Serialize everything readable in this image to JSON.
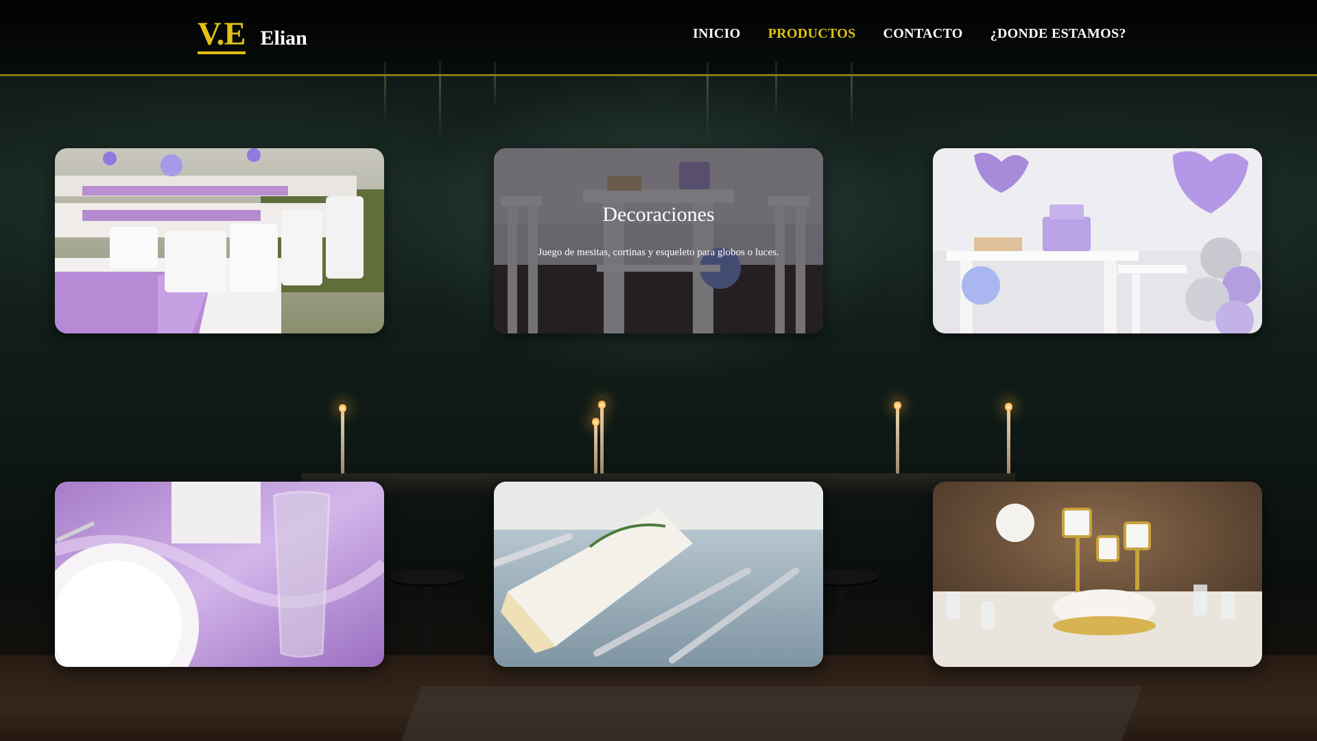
{
  "brand": {
    "mark": "V.E",
    "name": "Elian",
    "accent_color": "#e0c217"
  },
  "nav": {
    "items": [
      {
        "label": "INICIO",
        "active": false
      },
      {
        "label": "PRODUCTOS",
        "active": true
      },
      {
        "label": "CONTACTO",
        "active": false
      },
      {
        "label": "¿DONDE ESTAMOS?",
        "active": false
      }
    ]
  },
  "gallery": {
    "cards": [
      {
        "image": "event-tables-lilac-runners-photo",
        "title": "",
        "description": ""
      },
      {
        "image": "dessert-table-decor-photo",
        "title": "Decoraciones",
        "description": "Juego de mesitas, cortinas y esqueleto para globos o luces."
      },
      {
        "image": "lilac-balloons-dessert-table-photo",
        "title": "",
        "description": ""
      },
      {
        "image": "glassware-lilac-satin-photo",
        "title": "",
        "description": ""
      },
      {
        "image": "napkin-forks-place-setting-photo",
        "title": "",
        "description": ""
      },
      {
        "image": "banquet-candelabra-centerpiece-photo",
        "title": "",
        "description": ""
      }
    ]
  }
}
